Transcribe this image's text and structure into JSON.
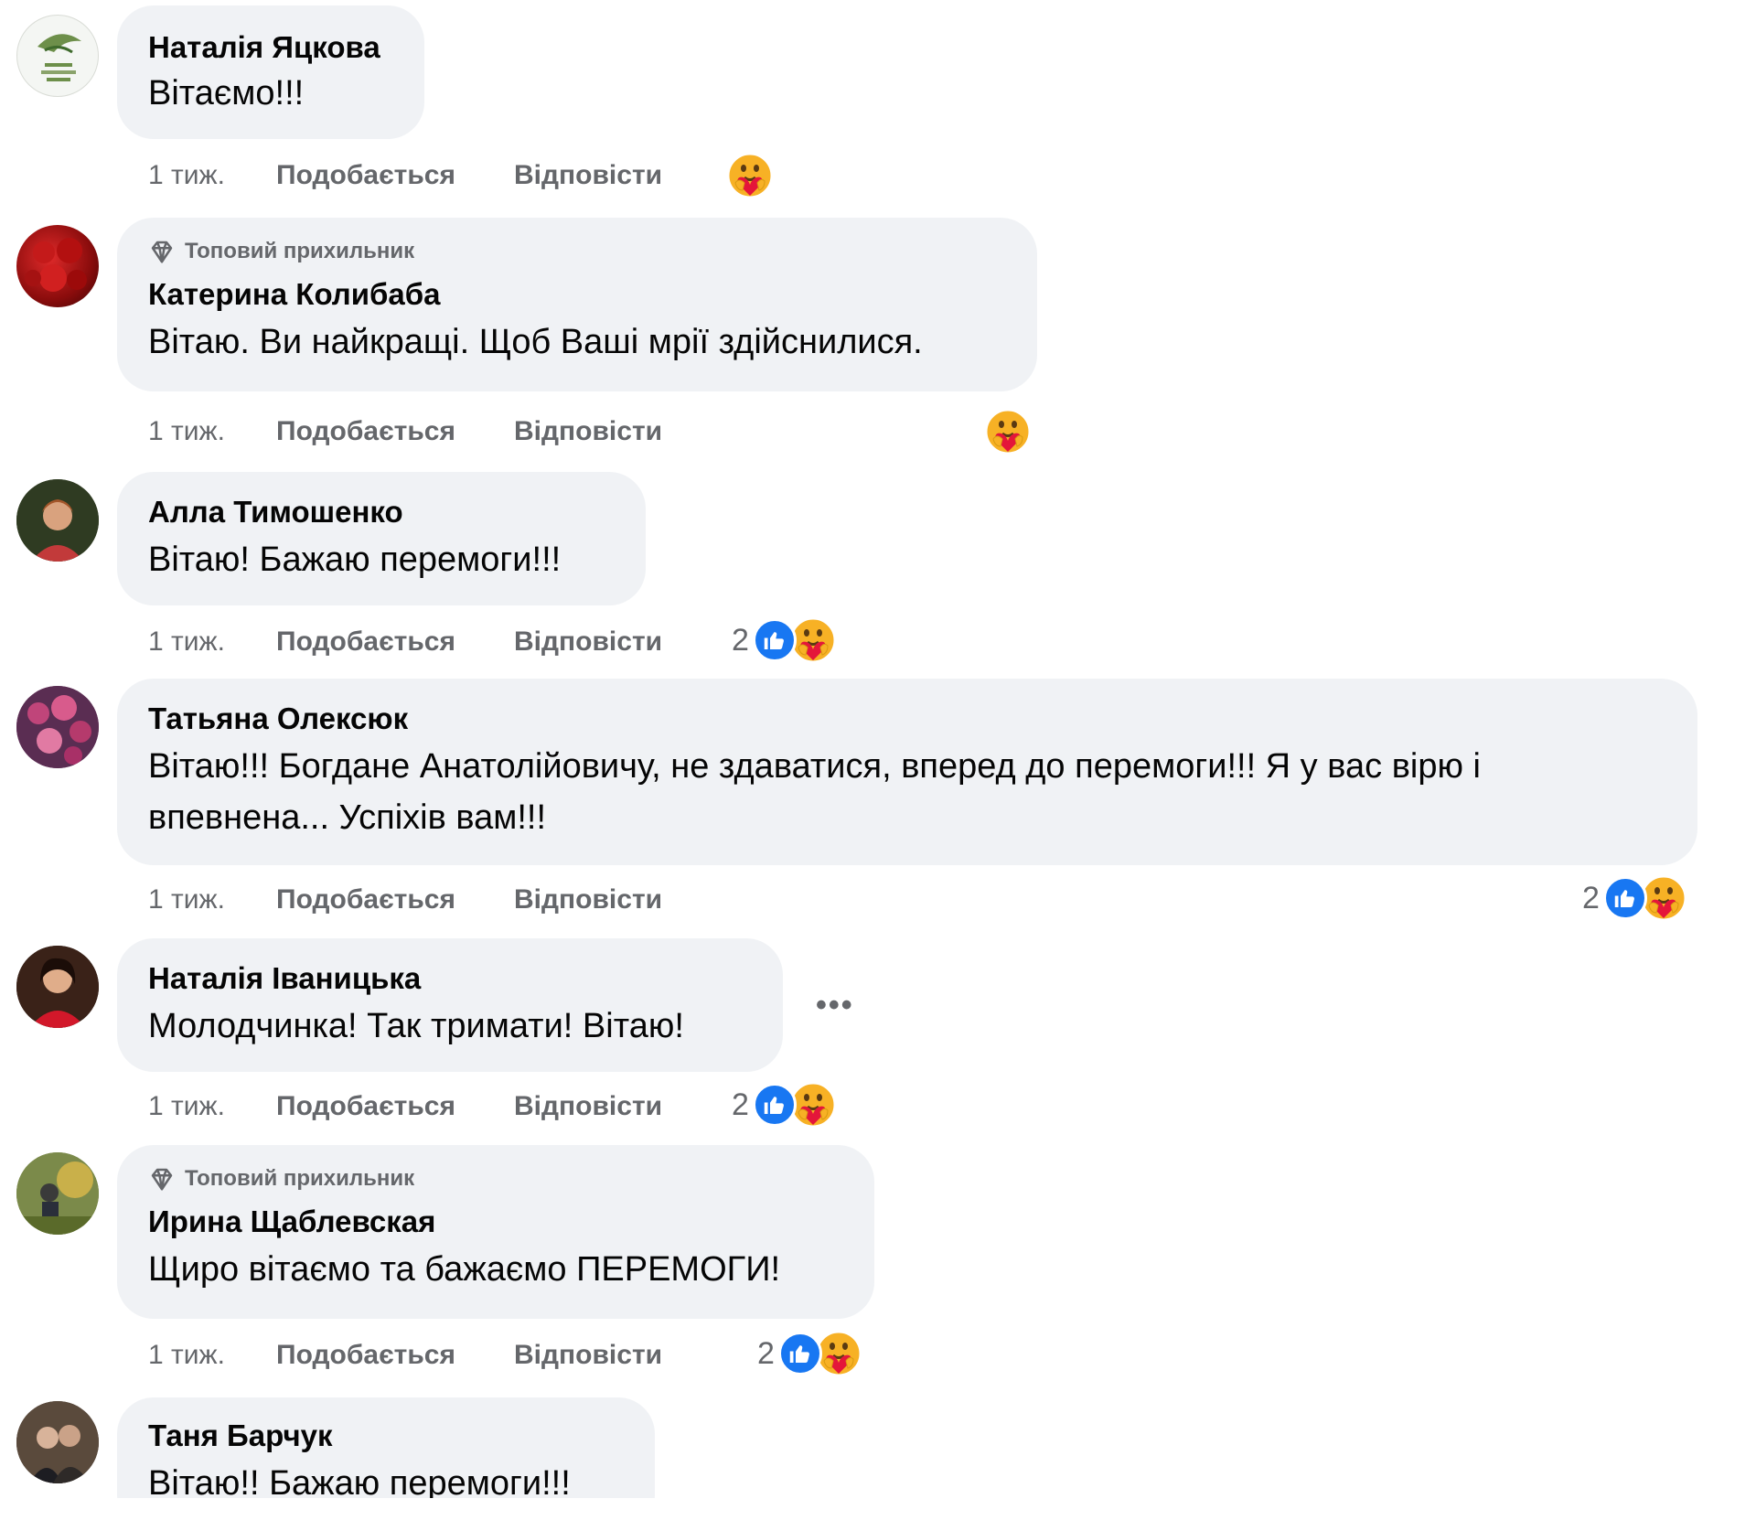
{
  "labels": {
    "like": "Подобається",
    "reply": "Відповісти",
    "top_fan": "Топовий прихильник",
    "more": "•••"
  },
  "comments": [
    {
      "name": "Наталія Яцкова",
      "text": "Вітаємо!!!",
      "time": "1 тиж.",
      "reaction_count": ""
    },
    {
      "name": "Катерина Колибаба",
      "text": "Вітаю. Ви найкращі. Щоб Ваші мрії здійснилися.",
      "time": "1 тиж.",
      "reaction_count": ""
    },
    {
      "name": "Алла Тимошенко",
      "text": "Вітаю! Бажаю перемоги!!!",
      "time": "1 тиж.",
      "reaction_count": "2"
    },
    {
      "name": "Татьяна Олексюк",
      "text": "Вітаю!!! Богдане Анатолійовичу, не здаватися, вперед до перемоги!!! Я у вас вірю і впевнена... Успіхів вам!!!",
      "time": "1 тиж.",
      "reaction_count": "2"
    },
    {
      "name": "Наталія Іваницька",
      "text": "Молодчинка! Так тримати! Вітаю!",
      "time": "1 тиж.",
      "reaction_count": "2"
    },
    {
      "name": "Ирина Щаблевская",
      "text": "Щиро вітаємо та бажаємо ПЕРЕМОГИ!",
      "time": "1 тиж.",
      "reaction_count": "2"
    },
    {
      "name": "Таня Барчук",
      "text": "Вітаю!! Бажаю перемоги!!!",
      "time": "",
      "reaction_count": ""
    }
  ],
  "colors": {
    "bubble": "#f0f2f5",
    "muted": "#65676b",
    "like_blue": "#1877f2"
  }
}
